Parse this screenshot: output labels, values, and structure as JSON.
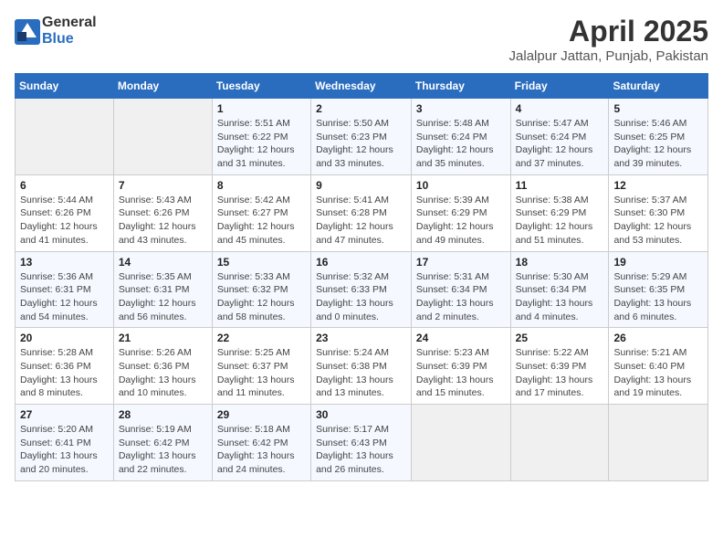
{
  "logo": {
    "general": "General",
    "blue": "Blue"
  },
  "title": {
    "month": "April 2025",
    "location": "Jalalpur Jattan, Punjab, Pakistan"
  },
  "weekdays": [
    "Sunday",
    "Monday",
    "Tuesday",
    "Wednesday",
    "Thursday",
    "Friday",
    "Saturday"
  ],
  "weeks": [
    [
      {
        "day": "",
        "info": ""
      },
      {
        "day": "",
        "info": ""
      },
      {
        "day": "1",
        "info": "Sunrise: 5:51 AM\nSunset: 6:22 PM\nDaylight: 12 hours and 31 minutes."
      },
      {
        "day": "2",
        "info": "Sunrise: 5:50 AM\nSunset: 6:23 PM\nDaylight: 12 hours and 33 minutes."
      },
      {
        "day": "3",
        "info": "Sunrise: 5:48 AM\nSunset: 6:24 PM\nDaylight: 12 hours and 35 minutes."
      },
      {
        "day": "4",
        "info": "Sunrise: 5:47 AM\nSunset: 6:24 PM\nDaylight: 12 hours and 37 minutes."
      },
      {
        "day": "5",
        "info": "Sunrise: 5:46 AM\nSunset: 6:25 PM\nDaylight: 12 hours and 39 minutes."
      }
    ],
    [
      {
        "day": "6",
        "info": "Sunrise: 5:44 AM\nSunset: 6:26 PM\nDaylight: 12 hours and 41 minutes."
      },
      {
        "day": "7",
        "info": "Sunrise: 5:43 AM\nSunset: 6:26 PM\nDaylight: 12 hours and 43 minutes."
      },
      {
        "day": "8",
        "info": "Sunrise: 5:42 AM\nSunset: 6:27 PM\nDaylight: 12 hours and 45 minutes."
      },
      {
        "day": "9",
        "info": "Sunrise: 5:41 AM\nSunset: 6:28 PM\nDaylight: 12 hours and 47 minutes."
      },
      {
        "day": "10",
        "info": "Sunrise: 5:39 AM\nSunset: 6:29 PM\nDaylight: 12 hours and 49 minutes."
      },
      {
        "day": "11",
        "info": "Sunrise: 5:38 AM\nSunset: 6:29 PM\nDaylight: 12 hours and 51 minutes."
      },
      {
        "day": "12",
        "info": "Sunrise: 5:37 AM\nSunset: 6:30 PM\nDaylight: 12 hours and 53 minutes."
      }
    ],
    [
      {
        "day": "13",
        "info": "Sunrise: 5:36 AM\nSunset: 6:31 PM\nDaylight: 12 hours and 54 minutes."
      },
      {
        "day": "14",
        "info": "Sunrise: 5:35 AM\nSunset: 6:31 PM\nDaylight: 12 hours and 56 minutes."
      },
      {
        "day": "15",
        "info": "Sunrise: 5:33 AM\nSunset: 6:32 PM\nDaylight: 12 hours and 58 minutes."
      },
      {
        "day": "16",
        "info": "Sunrise: 5:32 AM\nSunset: 6:33 PM\nDaylight: 13 hours and 0 minutes."
      },
      {
        "day": "17",
        "info": "Sunrise: 5:31 AM\nSunset: 6:34 PM\nDaylight: 13 hours and 2 minutes."
      },
      {
        "day": "18",
        "info": "Sunrise: 5:30 AM\nSunset: 6:34 PM\nDaylight: 13 hours and 4 minutes."
      },
      {
        "day": "19",
        "info": "Sunrise: 5:29 AM\nSunset: 6:35 PM\nDaylight: 13 hours and 6 minutes."
      }
    ],
    [
      {
        "day": "20",
        "info": "Sunrise: 5:28 AM\nSunset: 6:36 PM\nDaylight: 13 hours and 8 minutes."
      },
      {
        "day": "21",
        "info": "Sunrise: 5:26 AM\nSunset: 6:36 PM\nDaylight: 13 hours and 10 minutes."
      },
      {
        "day": "22",
        "info": "Sunrise: 5:25 AM\nSunset: 6:37 PM\nDaylight: 13 hours and 11 minutes."
      },
      {
        "day": "23",
        "info": "Sunrise: 5:24 AM\nSunset: 6:38 PM\nDaylight: 13 hours and 13 minutes."
      },
      {
        "day": "24",
        "info": "Sunrise: 5:23 AM\nSunset: 6:39 PM\nDaylight: 13 hours and 15 minutes."
      },
      {
        "day": "25",
        "info": "Sunrise: 5:22 AM\nSunset: 6:39 PM\nDaylight: 13 hours and 17 minutes."
      },
      {
        "day": "26",
        "info": "Sunrise: 5:21 AM\nSunset: 6:40 PM\nDaylight: 13 hours and 19 minutes."
      }
    ],
    [
      {
        "day": "27",
        "info": "Sunrise: 5:20 AM\nSunset: 6:41 PM\nDaylight: 13 hours and 20 minutes."
      },
      {
        "day": "28",
        "info": "Sunrise: 5:19 AM\nSunset: 6:42 PM\nDaylight: 13 hours and 22 minutes."
      },
      {
        "day": "29",
        "info": "Sunrise: 5:18 AM\nSunset: 6:42 PM\nDaylight: 13 hours and 24 minutes."
      },
      {
        "day": "30",
        "info": "Sunrise: 5:17 AM\nSunset: 6:43 PM\nDaylight: 13 hours and 26 minutes."
      },
      {
        "day": "",
        "info": ""
      },
      {
        "day": "",
        "info": ""
      },
      {
        "day": "",
        "info": ""
      }
    ]
  ]
}
